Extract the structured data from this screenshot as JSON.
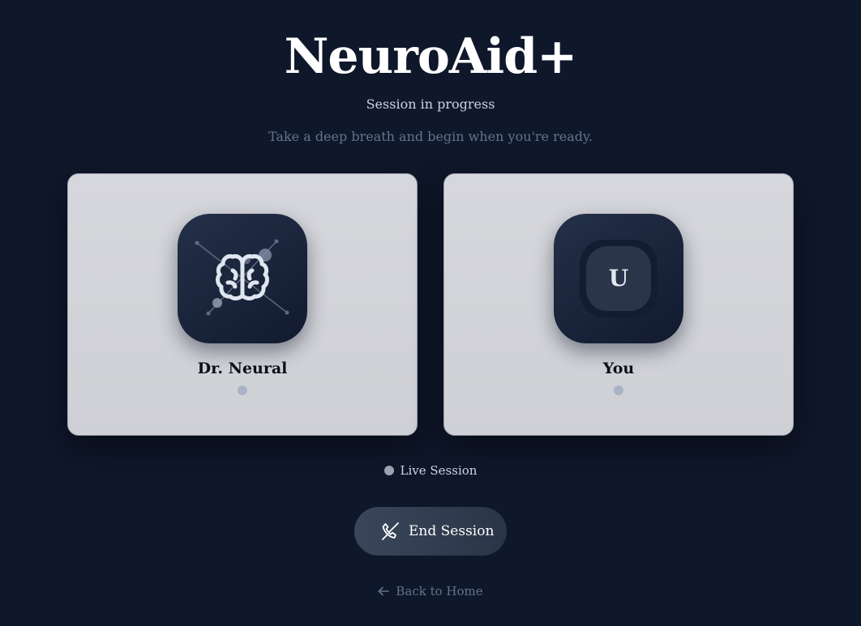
{
  "header": {
    "title": "NeuroAid+",
    "subtitle": "Session in progress",
    "hint": "Take a deep breath and begin when you're ready."
  },
  "participants": [
    {
      "name": "Dr. Neural",
      "icon": "brain-icon"
    },
    {
      "name": "You",
      "avatar_initial": "U"
    }
  ],
  "status": {
    "label": "Live Session"
  },
  "actions": {
    "end_session_label": "End Session",
    "end_session_icon": "phone-off-icon",
    "back_label": "Back to Home",
    "back_icon": "arrow-left-icon"
  },
  "colors": {
    "background": "#0f172a",
    "card": "#d2d3d8",
    "tile": "#1b2438",
    "button": "#334155"
  }
}
